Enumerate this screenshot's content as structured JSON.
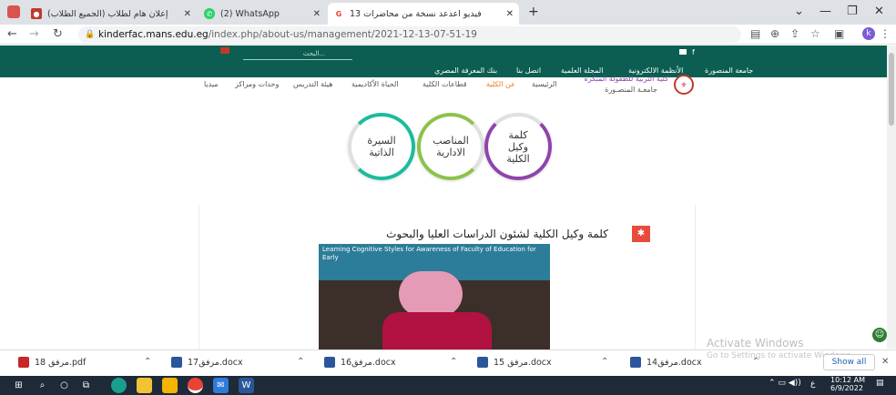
{
  "browser": {
    "tabs": [
      {
        "title": "إعلان هام لطلاب (الجميع الطلاب)",
        "active": false
      },
      {
        "title": "(2) WhatsApp",
        "active": false
      },
      {
        "title": "فيديو اعدعد نسخة من محاضرات 13",
        "active": true
      }
    ],
    "url_host": "kinderfac.mans.edu.eg",
    "url_path": "/index.php/about-us/management/2021-12-13-07-51-19",
    "avatar_letter": "k",
    "new_tab": "+"
  },
  "site": {
    "search_placeholder": "البحث...",
    "top_links": [
      "جامعة المنصورة",
      "الأنظمة الالكترونية",
      "المجلة العلمية",
      "اتصل بنا",
      "بنك المعرفة المصري"
    ],
    "logo_title": "كلية التربية للطفولة المبكرة",
    "logo_subtitle": "جامعـة المنصـورة",
    "menu": [
      {
        "label": "الرئيسية",
        "active": false
      },
      {
        "label": "عن الكلية",
        "active": true
      },
      {
        "label": "قطاعات الكلية",
        "active": false
      },
      {
        "label": "الحياة الأكاديمية",
        "active": false
      },
      {
        "label": "هيئة التدريس",
        "active": false
      },
      {
        "label": "وحدات ومراكز",
        "active": false
      },
      {
        "label": "ميديا",
        "active": false
      }
    ],
    "circles": [
      {
        "label": "السيرة الذاتية",
        "color": "#1abc9c"
      },
      {
        "label": "المناصب الادارية",
        "color": "#8bc34a"
      },
      {
        "label": "كلمة وكيل الكلية",
        "color": "#8e44ad"
      }
    ],
    "section_title": "كلمة وكيل الكلية لشئون الدراسات العليا والبحوث",
    "photo_banner": "Learning Cognitive Styles for Awareness of Faculty of Education for Early"
  },
  "downloads": {
    "items": [
      {
        "name": "مرفق 18.pdf",
        "type": "pdf"
      },
      {
        "name": "مرفق17.docx",
        "type": "doc"
      },
      {
        "name": "مرفق16.docx",
        "type": "doc"
      },
      {
        "name": "مرفق 15.docx",
        "type": "doc"
      },
      {
        "name": "مرفق14.docx",
        "type": "doc"
      }
    ],
    "show_all": "Show all"
  },
  "windows": {
    "activate_title": "Activate Windows",
    "activate_sub": "Go to Settings to activate Windows.",
    "time": "10:12 AM",
    "date": "6/9/2022",
    "lang": "ع"
  }
}
